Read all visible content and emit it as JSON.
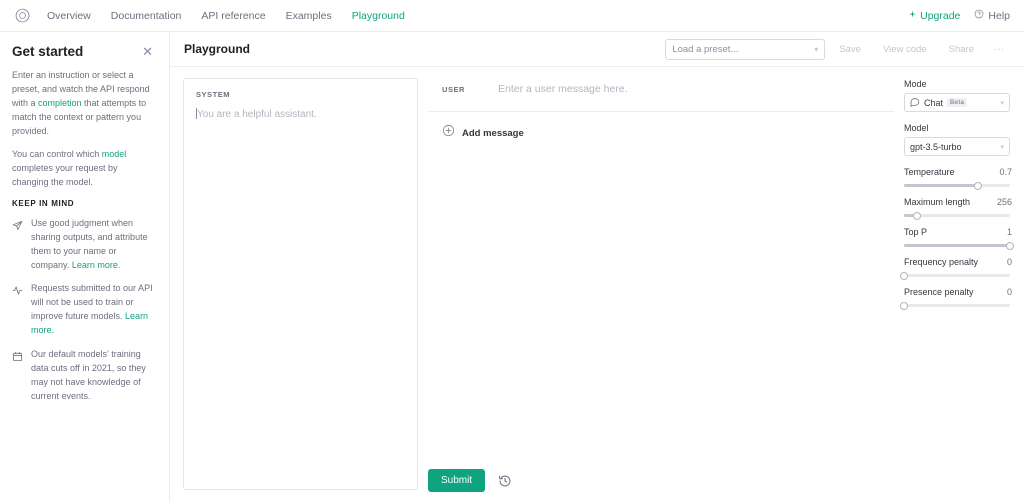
{
  "nav": {
    "logo_icon": "openai-logo-icon",
    "links": [
      {
        "label": "Overview",
        "active": false
      },
      {
        "label": "Documentation",
        "active": false
      },
      {
        "label": "API reference",
        "active": false
      },
      {
        "label": "Examples",
        "active": false
      },
      {
        "label": "Playground",
        "active": true
      }
    ],
    "upgrade_label": "Upgrade",
    "upgrade_icon": "sparkle-icon",
    "help_label": "Help",
    "help_icon": "question-circle-icon",
    "accent_color": "#10a37f"
  },
  "sidebar": {
    "title": "Get started",
    "close_icon": "close-icon",
    "paragraphs": [
      {
        "pre": "Enter an instruction or select a preset, and watch the API respond with a ",
        "link": "completion",
        "post": " that attempts to match the context or pattern you provided."
      },
      {
        "pre": "You can control which ",
        "link": "model",
        "post": " completes your request by changing the model."
      }
    ],
    "keep_in_mind_title": "KEEP IN MIND",
    "keep_in_mind": [
      {
        "icon": "paper-plane-icon",
        "text": "Use good judgment when sharing outputs, and attribute them to your name or company. ",
        "link": "Learn more."
      },
      {
        "icon": "activity-pulse-icon",
        "text": "Requests submitted to our API will not be used to train or improve future models. ",
        "link": "Learn more."
      },
      {
        "icon": "calendar-icon",
        "text": "Our default models' training data cuts off in 2021, so they may not have knowledge of current events.",
        "link": ""
      }
    ]
  },
  "toolbar": {
    "title": "Playground",
    "preset_placeholder": "Load a preset...",
    "preset_caret_icon": "chevron-down-icon",
    "save_label": "Save",
    "view_code_label": "View code",
    "share_label": "Share",
    "more_label": "···"
  },
  "system_panel": {
    "label": "SYSTEM",
    "placeholder": "You are a helpful assistant."
  },
  "messages": {
    "rows": [
      {
        "role": "USER",
        "placeholder": "Enter a user message here."
      }
    ],
    "add_message_label": "Add message",
    "add_message_icon": "plus-circle-icon"
  },
  "submit": {
    "label": "Submit",
    "history_icon": "history-clock-icon"
  },
  "params": {
    "mode_label": "Mode",
    "mode_value": "Chat",
    "mode_icon": "chat-bubble-icon",
    "mode_badge": "Beta",
    "model_label": "Model",
    "model_value": "gpt-3.5-turbo",
    "caret_icon": "chevron-down-icon",
    "sliders": [
      {
        "name": "Temperature",
        "value": "0.7",
        "percent": 70
      },
      {
        "name": "Maximum length",
        "value": "256",
        "percent": 12
      },
      {
        "name": "Top P",
        "value": "1",
        "percent": 100
      },
      {
        "name": "Frequency penalty",
        "value": "0",
        "percent": 0
      },
      {
        "name": "Presence penalty",
        "value": "0",
        "percent": 0
      }
    ]
  }
}
